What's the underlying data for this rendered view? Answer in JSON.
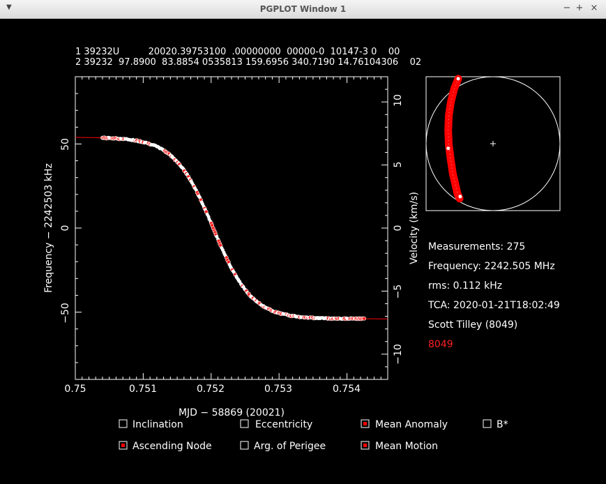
{
  "window": {
    "title": "PGPLOT Window 1",
    "menu_icon": "chevron-down-icon",
    "minimize_icon": "minimize-icon",
    "maximize_icon": "maximize-icon",
    "close_icon": "close-icon"
  },
  "tle": {
    "line1": "1 39232U          20020.39753100  .00000000  00000-0  10147-3 0    00",
    "line2": "2 39232  97.8900  83.8854 0535813 159.6956 340.7190 14.76104306    02"
  },
  "info": {
    "measurements": "Measurements: 275",
    "frequency": "Frequency: 2242.505 MHz",
    "rms": "rms: 0.112 kHz",
    "tca": "TCA: 2020-01-21T18:02:49",
    "observer": "Scott Tilley (8049)",
    "station": "8049"
  },
  "checkboxes": [
    {
      "label": "Inclination",
      "checked": false
    },
    {
      "label": "Eccentricity",
      "checked": false
    },
    {
      "label": "Mean Anomaly",
      "checked": true
    },
    {
      "label": "B*",
      "checked": false
    },
    {
      "label": "Ascending Node",
      "checked": true
    },
    {
      "label": "Arg. of Perigee",
      "checked": false
    },
    {
      "label": "Mean Motion",
      "checked": true
    }
  ],
  "colors": {
    "background": "#000000",
    "axes": "#ffffff",
    "fit": "#ff0000",
    "station": "#ff2020"
  },
  "chart_data": [
    {
      "type": "scatter",
      "xlabel": "MJD − 58869 (20021)",
      "ylabel": "Frequency − 2242503 kHz",
      "y2label": "Velocity (km/s)",
      "xlim": [
        0.75,
        0.7546
      ],
      "ylim": [
        -90,
        90
      ],
      "y2lim": [
        -12,
        12
      ],
      "xticks": [
        "0.75",
        "0.751",
        "0.752",
        "0.753",
        "0.754"
      ],
      "yticks": [
        "50",
        "0",
        "−50"
      ],
      "y2ticks": [
        "10",
        "5",
        "0",
        "−5",
        "−10"
      ],
      "fit": {
        "center_x": 0.75203,
        "amplitude": 54,
        "width": 0.00057,
        "offset": 0
      },
      "measurements": {
        "count": 275,
        "x_start": 0.7504,
        "x_end": 0.75425
      }
    },
    {
      "type": "scatter",
      "description_key": "sky-view",
      "ground_track_points": [
        [
          -0.52,
          -0.97
        ],
        [
          -0.58,
          -0.82
        ],
        [
          -0.63,
          -0.62
        ],
        [
          -0.66,
          -0.42
        ],
        [
          -0.67,
          -0.2
        ],
        [
          -0.66,
          0.02
        ],
        [
          -0.63,
          0.25
        ],
        [
          -0.6,
          0.45
        ],
        [
          -0.56,
          0.62
        ],
        [
          -0.53,
          0.75
        ],
        [
          -0.5,
          0.82
        ]
      ],
      "highlight_points": [
        [
          -0.67,
          0.07
        ],
        [
          -0.52,
          -0.97
        ],
        [
          -0.49,
          0.79
        ]
      ]
    }
  ]
}
